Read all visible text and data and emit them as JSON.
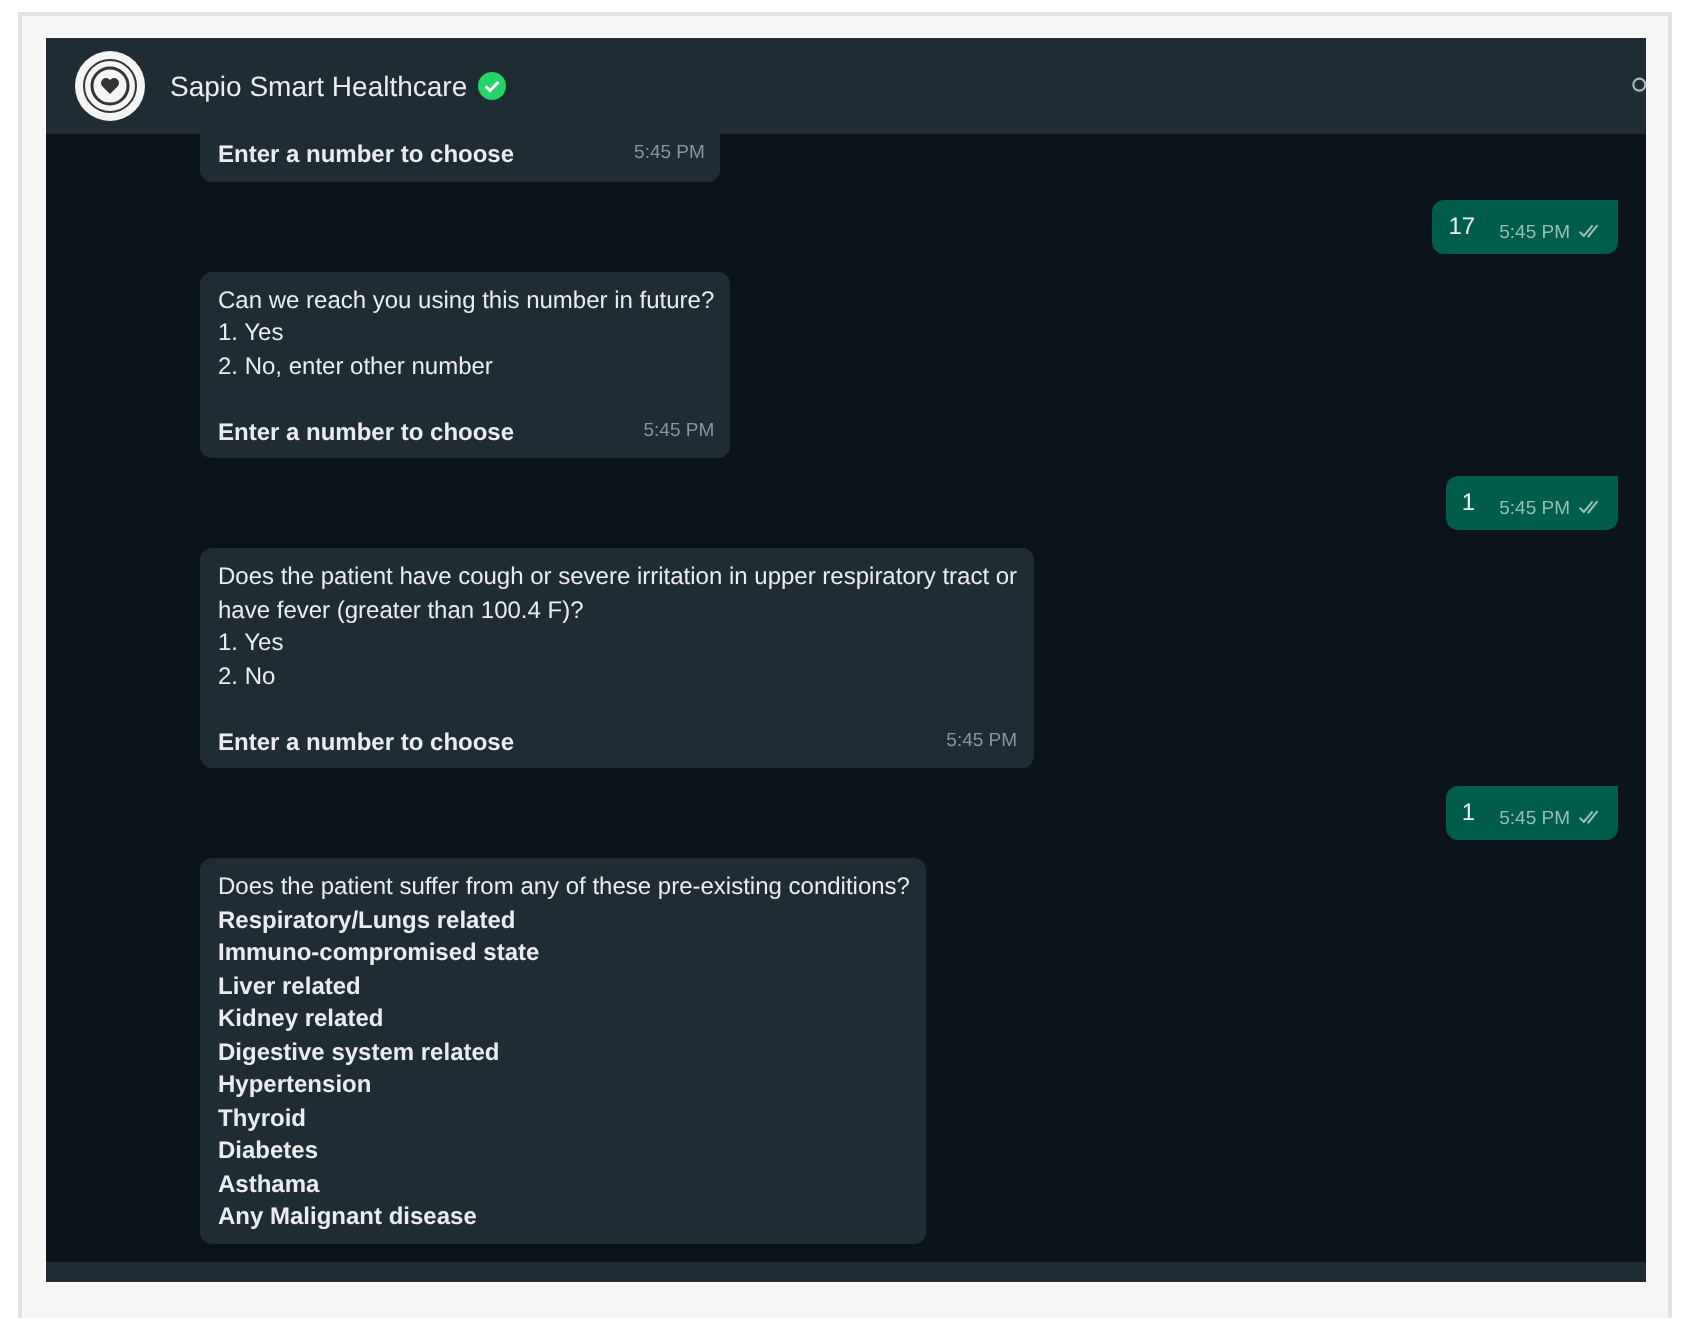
{
  "header": {
    "name": "Sapio Smart Healthcare",
    "verified": true
  },
  "messages": [
    {
      "kind": "received",
      "paragraphs": [
        [
          {
            "text": "Enter a number to choose",
            "bold": true
          }
        ]
      ],
      "time": "5:45 PM"
    },
    {
      "kind": "sent",
      "text": "17",
      "time": "5:45 PM"
    },
    {
      "kind": "received",
      "paragraphs": [
        [
          {
            "text": "Can we reach you using this number in future?",
            "bold": false
          },
          {
            "text": "1. Yes",
            "bold": false
          },
          {
            "text": "2. No, enter other number",
            "bold": false
          }
        ],
        [
          {
            "text": "Enter a number to choose",
            "bold": true
          }
        ]
      ],
      "time": "5:45 PM"
    },
    {
      "kind": "sent",
      "text": "1",
      "time": "5:45 PM"
    },
    {
      "kind": "received",
      "paragraphs": [
        [
          {
            "text": "Does the patient have cough or severe irritation in upper respiratory tract or",
            "bold": false
          },
          {
            "text": "have fever (greater than 100.4 F)?",
            "bold": false
          },
          {
            "text": "1. Yes",
            "bold": false
          },
          {
            "text": "2. No",
            "bold": false
          }
        ],
        [
          {
            "text": "Enter a number to choose",
            "bold": true
          }
        ]
      ],
      "time": "5:45 PM"
    },
    {
      "kind": "sent",
      "text": "1",
      "time": "5:45 PM"
    },
    {
      "kind": "received",
      "paragraphs": [
        [
          {
            "text": "Does the patient suffer from any of these pre-existing conditions?",
            "bold": false
          },
          {
            "text": "Respiratory/Lungs related",
            "bold": true
          },
          {
            "text": "Immuno-compromised state",
            "bold": true
          },
          {
            "text": "Liver related",
            "bold": true
          },
          {
            "text": "Kidney related",
            "bold": true
          },
          {
            "text": "Digestive system related",
            "bold": true
          },
          {
            "text": "Hypertension",
            "bold": true
          },
          {
            "text": "Thyroid",
            "bold": true
          },
          {
            "text": "Diabetes",
            "bold": true
          },
          {
            "text": "Asthama",
            "bold": true
          },
          {
            "text": "Any Malignant disease",
            "bold": true
          }
        ]
      ]
    }
  ]
}
